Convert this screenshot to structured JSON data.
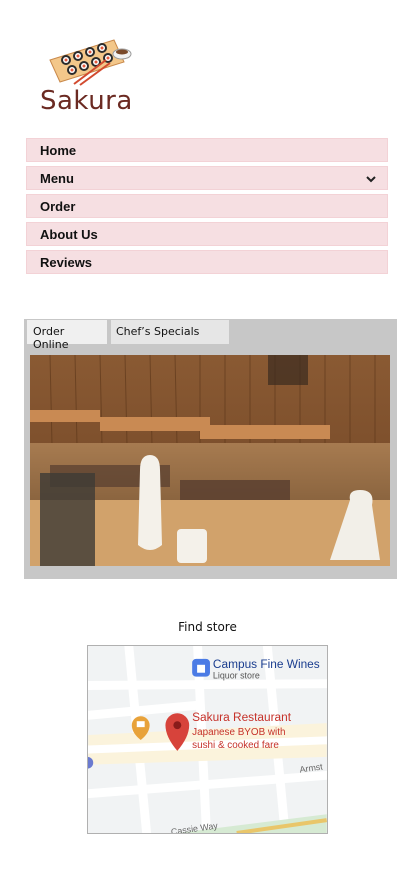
{
  "brand": {
    "name": "Sakura"
  },
  "nav": {
    "items": [
      {
        "label": "Home"
      },
      {
        "label": "Menu"
      },
      {
        "label": "Order"
      },
      {
        "label": "About Us"
      },
      {
        "label": "Reviews"
      }
    ]
  },
  "tabs": {
    "items": [
      {
        "label": "Order Online",
        "active": true
      },
      {
        "label": "Chef’s Specials",
        "active": false
      }
    ]
  },
  "find_store": {
    "label": "Find store"
  },
  "map": {
    "poi_1_name": "Campus Fine Wines",
    "poi_1_type": "Liquor store",
    "poi_2_name": "Sakura Restaurant",
    "poi_2_desc_line1": "Japanese BYOB with",
    "poi_2_desc_line2": "sushi & cooked fare",
    "street_1": "Armst",
    "street_2": "Cassie Way"
  },
  "colors": {
    "brand": "#6b2a22",
    "nav_bg": "#f6dfe2",
    "marker": "#d7433b",
    "liquor_icon": "#4b7be5",
    "cafe_icon": "#e8a23a"
  },
  "icons": [
    "sushi-logo-icon",
    "chevron-down-icon",
    "map-pin-icon",
    "shopping-bag-icon",
    "coffee-cup-icon"
  ]
}
